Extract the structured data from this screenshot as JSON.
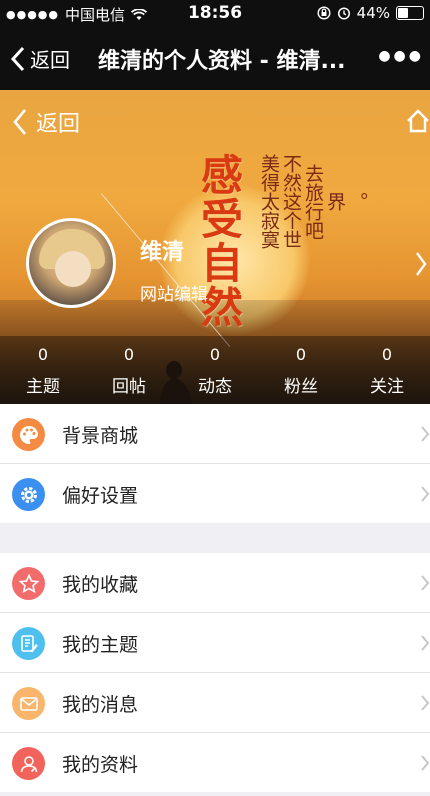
{
  "status": {
    "carrier": "中国电信",
    "time": "18:56",
    "battery": "44%",
    "battery_level": 0.44
  },
  "nav": {
    "back_label": "返回",
    "title": "维清的个人资料 - 维清..."
  },
  "profile": {
    "back_label": "返回",
    "name": "维清",
    "role": "网站编辑",
    "banner_title": [
      "感",
      "受",
      "自",
      "然"
    ],
    "banner_poem": [
      "美得太寂寞",
      "不然这个世",
      "去旅行吧",
      "界",
      "。"
    ],
    "stats": [
      {
        "value": "0",
        "label": "主题"
      },
      {
        "value": "0",
        "label": "回帖"
      },
      {
        "value": "0",
        "label": "动态"
      },
      {
        "value": "0",
        "label": "粉丝"
      },
      {
        "value": "0",
        "label": "关注"
      }
    ]
  },
  "menu_group1": [
    {
      "label": "背景商城",
      "icon": "palette-icon",
      "color": "#f58b42"
    },
    {
      "label": "偏好设置",
      "icon": "gear-icon",
      "color": "#3b8ff0"
    }
  ],
  "menu_group2": [
    {
      "label": "我的收藏",
      "icon": "star-icon",
      "color": "#f36c6c"
    },
    {
      "label": "我的主题",
      "icon": "edit-doc-icon",
      "color": "#4fc0ee"
    },
    {
      "label": "我的消息",
      "icon": "envelope-icon",
      "color": "#f9b56b"
    },
    {
      "label": "我的资料",
      "icon": "user-icon",
      "color": "#f2645b"
    }
  ]
}
